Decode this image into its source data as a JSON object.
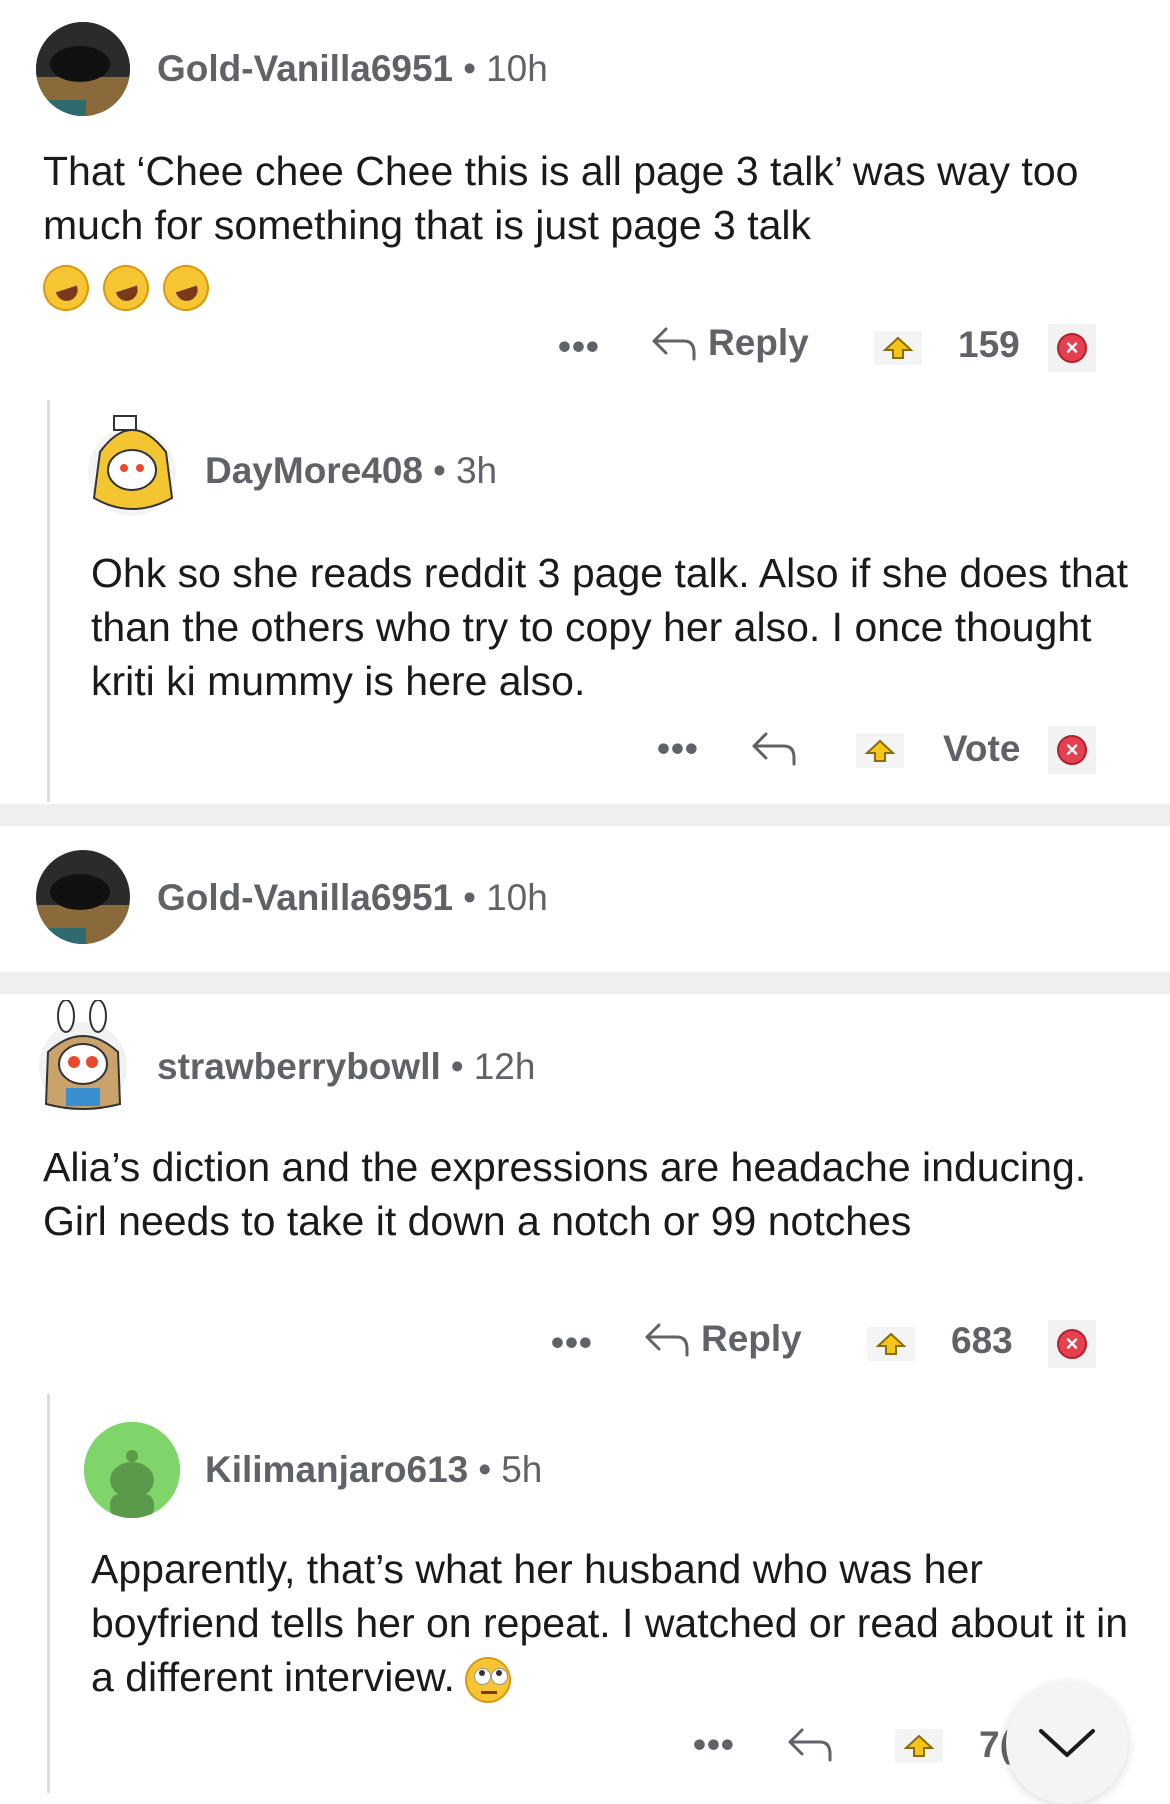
{
  "comments": [
    {
      "user": "Gold-Vanilla6951",
      "time": "10h",
      "text": "That ‘Chee chee Chee this is all page 3 talk’ was way too much for something that is just page 3 talk",
      "reply_label": "Reply",
      "score": "159",
      "emojis": [
        "rofl-emoji",
        "rofl-emoji",
        "rofl-emoji"
      ]
    },
    {
      "user": "DayMore408",
      "time": "3h",
      "text": "Ohk so she reads reddit 3 page talk. Also if she does that than the others who try to copy her also. I once thought kriti ki mummy is here also.",
      "score": "Vote"
    },
    {
      "user": "Gold-Vanilla6951",
      "time": "10h"
    },
    {
      "user": "strawberrybowll",
      "time": "12h",
      "text": "Alia’s diction and the expressions are headache inducing. Girl needs to take it down a notch or 99 notches",
      "reply_label": "Reply",
      "score": "683"
    },
    {
      "user": "Kilimanjaro613",
      "time": "5h",
      "text": "Apparently, that’s what her husband who was her boyfriend tells her on repeat. I watched or read about it in a different interview.",
      "score": "7("
    }
  ],
  "more_dots": "•••",
  "separator_dot": "•",
  "colors": {
    "meta": "#5f6368",
    "downvote": "#e4404f",
    "thread_line": "#dcdcdc",
    "green_avatar": "#7fd46a"
  },
  "icons": [
    "reply-arrow-icon",
    "upvote-icon",
    "downvote-icon",
    "chevron-down-icon"
  ]
}
